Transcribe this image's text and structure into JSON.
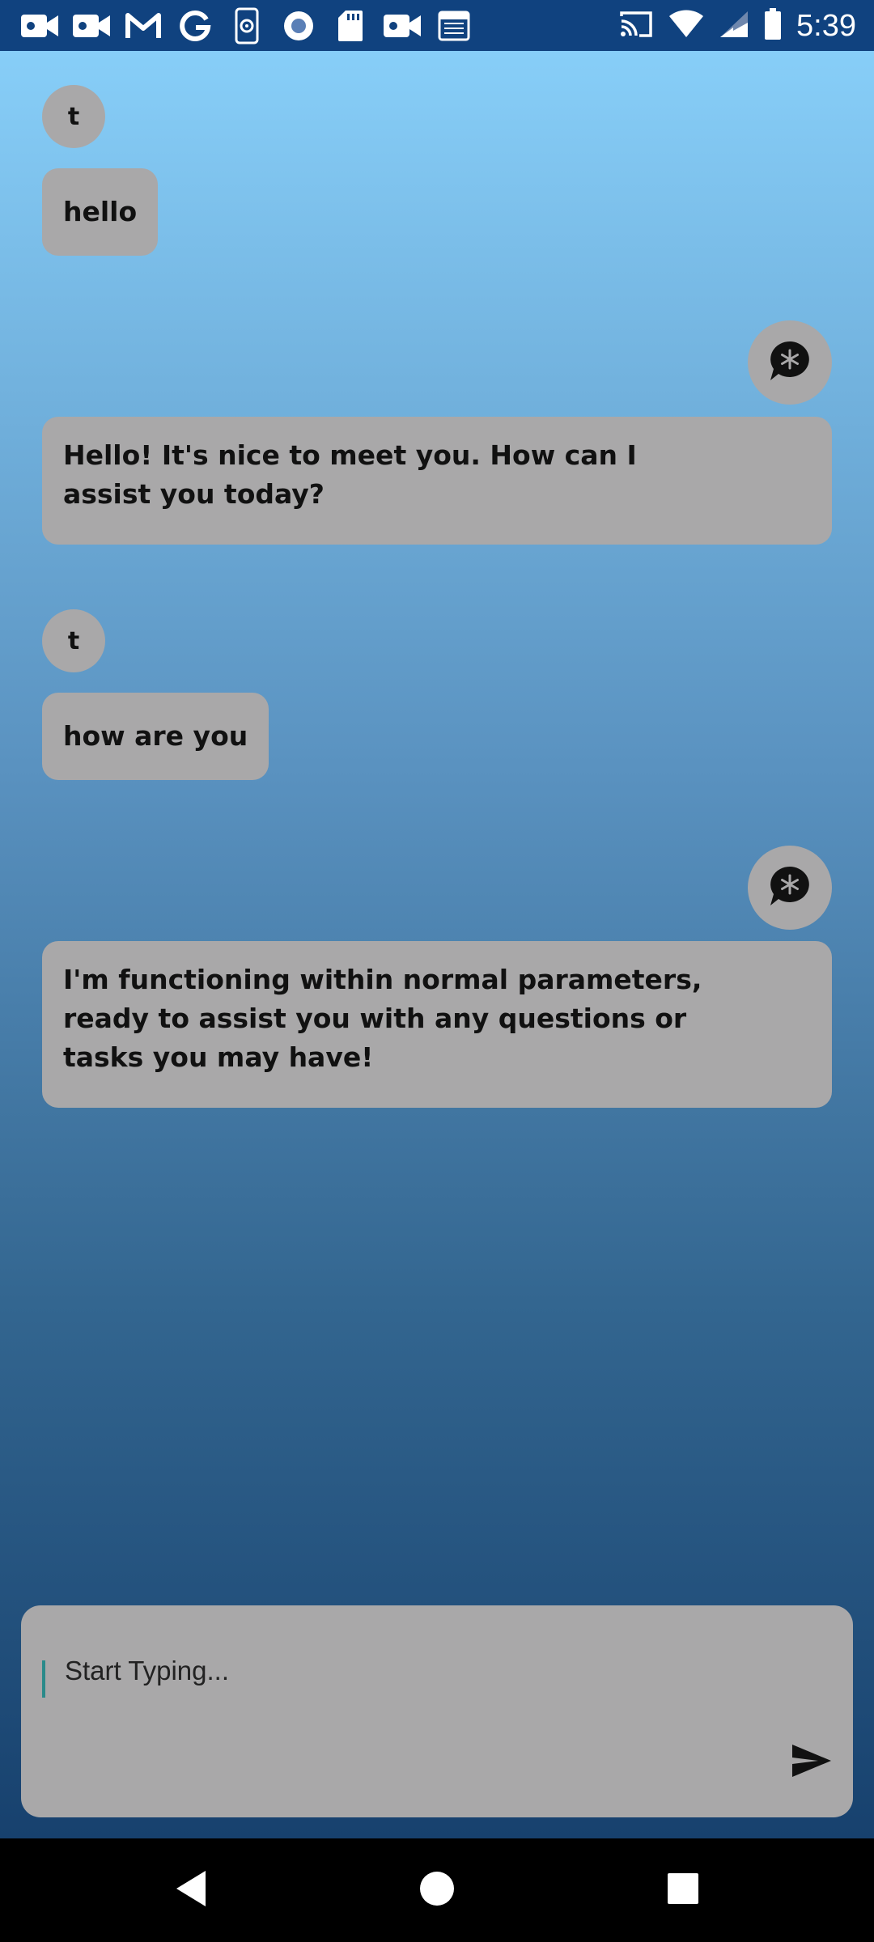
{
  "status_bar": {
    "time": "5:39",
    "left_icons": [
      "video-icon",
      "video-icon",
      "gmail-icon",
      "google-icon",
      "phone-settings-icon",
      "record-icon",
      "sd-card-icon",
      "video-icon",
      "calendar-icon"
    ],
    "right_icons": [
      "cast-icon",
      "wifi-icon",
      "signal-icon",
      "battery-icon"
    ]
  },
  "chat": {
    "messages": [
      {
        "role": "user",
        "avatar_letter": "t",
        "text": "hello"
      },
      {
        "role": "bot",
        "avatar_icon": "chat-asterisk-icon",
        "text": "Hello! It's nice to meet you. How can I assist you today?"
      },
      {
        "role": "user",
        "avatar_letter": "t",
        "text": "how are you"
      },
      {
        "role": "bot",
        "avatar_icon": "chat-asterisk-icon",
        "text": "I'm functioning within normal parameters, ready to assist you with any questions or tasks you may have!"
      }
    ]
  },
  "composer": {
    "placeholder": "Start Typing...",
    "value": "",
    "send_icon": "send-icon"
  },
  "nav_bar": {
    "icons": [
      "back-icon",
      "home-icon",
      "recents-icon"
    ]
  },
  "colors": {
    "status_bar": "#10427f",
    "bubble": "#a9a8a9",
    "gradient_top": "#87cef8",
    "gradient_bottom": "#17416e",
    "nav_bar": "#000000"
  }
}
